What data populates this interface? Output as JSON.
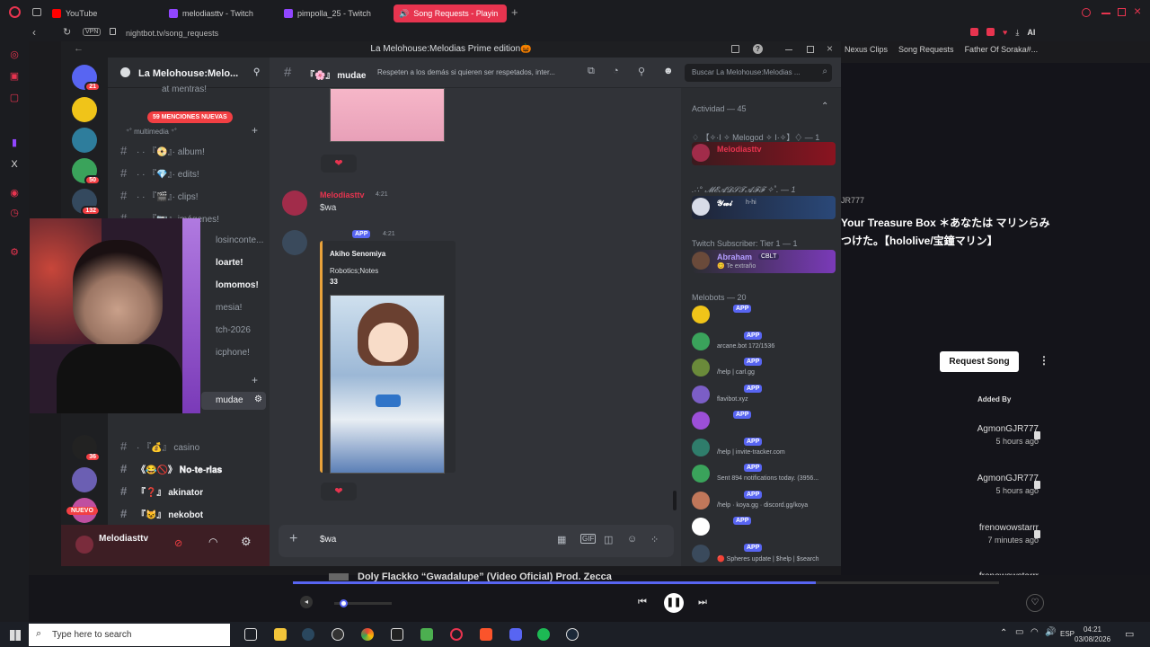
{
  "browser": {
    "tabs": [
      {
        "label": "YouTube",
        "color": "#ff0000"
      },
      {
        "label": "melodiasttv - Twitch",
        "color": "#9146ff"
      },
      {
        "label": "pimpolla_25 - Twitch",
        "color": "#9146ff"
      },
      {
        "label": "Song Requests - Playin",
        "color": "#ffffff"
      }
    ],
    "vpn_label": "VPN",
    "url": "nightbot.tv/song_requests",
    "bookmarks": [
      "Nexus Clips",
      "Song Requests",
      "Father Of Soraka#..."
    ],
    "ai_label": "AI"
  },
  "discord": {
    "window_title": "La Melohouse:Melodias Prime edition🎃",
    "guild_name": "La Melohouse:Melo...",
    "mentions_pill": "59 MENCIONES NUEVAS",
    "server_badges": [
      "21",
      "50",
      "132",
      "36"
    ],
    "new_badge": "NUEVO",
    "channel_top": "at mentras!",
    "category": "multimedia",
    "channels": [
      {
        "label": "· · 『📀』· album!",
        "bold": false
      },
      {
        "label": "· · 『💎』· edits!",
        "bold": false
      },
      {
        "label": "· · 『🎬』· clips!",
        "bold": false
      },
      {
        "label": "· · 『📷』· imágenes!",
        "bold": false
      }
    ],
    "hidden_channels": [
      "losinconte...",
      "loarte!",
      "lomomos!",
      "mesia!",
      "tch-2026",
      "icphone!"
    ],
    "current_channel_side": "mudae",
    "lower_channels": [
      {
        "label": "· 『💰』 casino",
        "bold": false
      },
      {
        "label": "《😂🚫》 𝐍𝐨-𝐭𝐞-𝐫𝐢𝐚𝐬",
        "bold": true
      },
      {
        "label": "『❓』 akinator",
        "bold": true
      },
      {
        "label": "『😺』 nekobot",
        "bold": true
      }
    ],
    "user": {
      "name": "Melodiasttv"
    },
    "header": {
      "channel": "『🌸』 mudae",
      "topic": "Respeten a los demás si quieren ser respetados, inter...",
      "search_placeholder": "Buscar La Melohouse:Melodias ..."
    },
    "messages": [
      {
        "author": "Melodiasttv",
        "time": "4:21",
        "text": "$wa"
      },
      {
        "author_badge": "APP",
        "time": "4:21",
        "embed": {
          "name": "Akiho Senomiya",
          "series": "Robotics;Notes",
          "value": "33"
        }
      }
    ],
    "reaction": "❤",
    "composer_text": "$wa",
    "members": {
      "activity_header": "Actividad — 45",
      "sections": [
        {
          "title": "♢ 【✧·I ✧ Melogod ✧ I·✧】♢ — 1",
          "members": [
            {
              "name": "Melodiasttv",
              "sub": "",
              "color": "#e7344f"
            }
          ]
        },
        {
          "title": ".∴° 𝓜𝓔𝓐𝓓𝓢𝓣𝓐𝓕𝓕 ✧˚. — 1",
          "members": [
            {
              "name": "𝓨𝔀𝓲",
              "sub": "h-hi",
              "color": "#ffffff"
            }
          ]
        },
        {
          "title": "Twitch Subscriber: Tier 1 — 1",
          "members": [
            {
              "name": "Abraham",
              "sub": "😊 Te extraño",
              "color": "#b39dff"
            }
          ]
        },
        {
          "title": "Melobots — 20",
          "members": [
            {
              "name": "",
              "sub": ""
            },
            {
              "name": "",
              "sub": "arcane.bot 172/1536"
            },
            {
              "name": "",
              "sub": "/help | carl.gg"
            },
            {
              "name": "",
              "sub": "flavibot.xyz"
            },
            {
              "name": "",
              "sub": ""
            },
            {
              "name": "",
              "sub": "/help | invite-tracker.com"
            },
            {
              "name": "",
              "sub": "Sent 894 notifications today. (3956..."
            },
            {
              "name": "",
              "sub": "/help · koya.gg · discord.gg/koya"
            },
            {
              "name": "",
              "sub": ""
            },
            {
              "name": "",
              "sub": "🔴 Spheres update | $help | $search"
            }
          ]
        }
      ],
      "cblt_badge": "CBLT",
      "app_label": "APP"
    }
  },
  "nightbot": {
    "user_tag": "JR777",
    "song_title": "Your Treasure Box ＊あなたは マリンらみつけた。【hololive/宝鐘マリン】",
    "request_button": "Request Song",
    "added_by_header": "Added By",
    "queue": [
      {
        "user": "AgmonGJR777",
        "when": "5 hours ago"
      },
      {
        "user": "AgmonGJR777",
        "when": "5 hours ago"
      },
      {
        "user": "frenowowstarrr",
        "when": "7 minutes ago"
      },
      {
        "user": "frenowowstarrr",
        "when": ""
      }
    ],
    "now_playing": "Doly Flackko “Gwadalupe” (Video Oficial) Prod. Zecca",
    "progress": 0.74,
    "volume": 0.15
  },
  "twitch_side": {
    "username": "melodiasttv"
  },
  "taskbar": {
    "search_placeholder": "Type here to search",
    "lang": "ESP",
    "time": "04:21",
    "date": "03/08/2026"
  },
  "colors": {
    "accent": "#e7344f",
    "discord_blurple": "#5865f2",
    "bg": "#313338"
  }
}
